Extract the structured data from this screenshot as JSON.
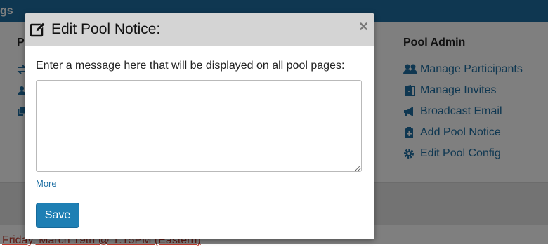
{
  "page": {
    "topbar_fragment": "gs",
    "left_heading_fragment": "P",
    "date_line": "Friday, March 19th @ 1:15PM (Eastern)"
  },
  "pool_admin": {
    "heading": "Pool Admin",
    "links": [
      {
        "label": "Manage Participants",
        "icon": "users-icon"
      },
      {
        "label": "Manage Invites",
        "icon": "door-icon"
      },
      {
        "label": "Broadcast Email",
        "icon": "megaphone-icon"
      },
      {
        "label": "Add Pool Notice",
        "icon": "clipboard-plus-icon"
      },
      {
        "label": "Edit Pool Config",
        "icon": "gear-icon"
      }
    ]
  },
  "modal": {
    "title": "Edit Pool Notice:",
    "close_label": "×",
    "prompt": "Enter a message here that will be displayed on all pool pages:",
    "textarea_value": "",
    "more_label": "More",
    "save_label": "Save"
  },
  "colors": {
    "accent": "#1e6fa3",
    "save_button": "#1e7fb4",
    "header_bg": "#d4d4d4"
  }
}
